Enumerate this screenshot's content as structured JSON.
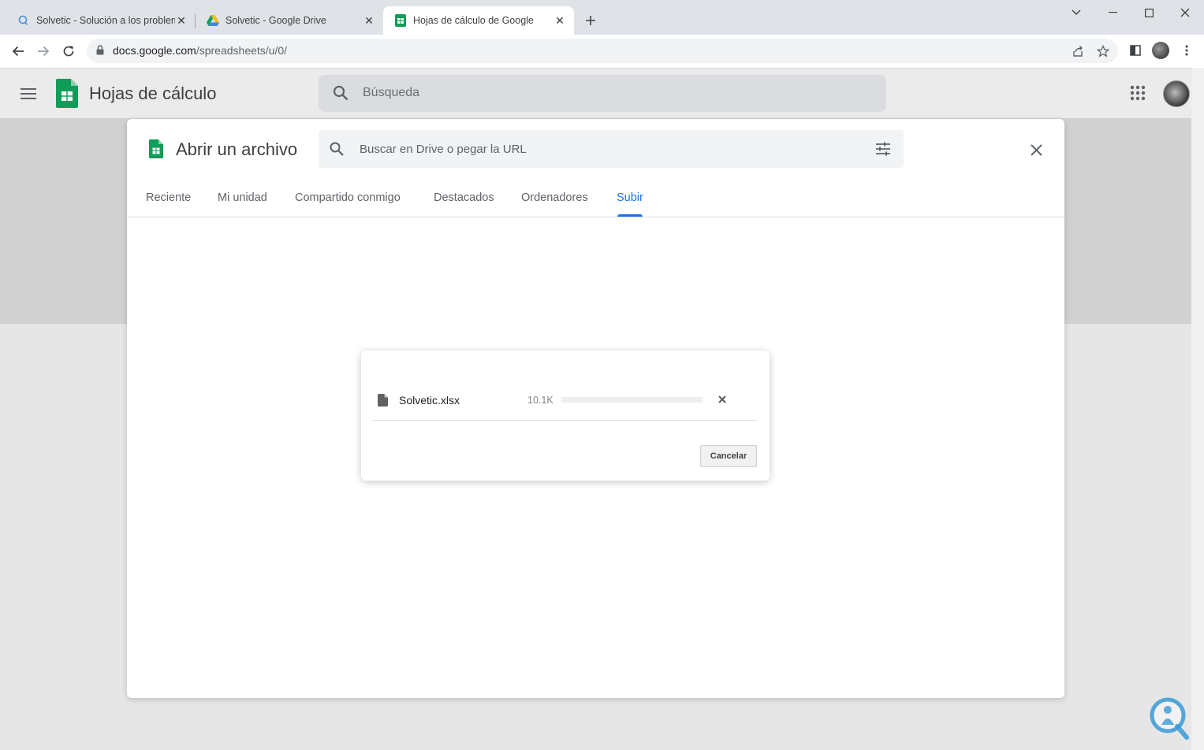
{
  "browser": {
    "tabs": [
      {
        "title": "Solvetic - Solución a los problem",
        "icon": "solvetic-favicon"
      },
      {
        "title": "Solvetic - Google Drive",
        "icon": "drive-favicon"
      },
      {
        "title": "Hojas de cálculo de Google",
        "icon": "sheets-favicon",
        "active": true
      }
    ],
    "url_host": "docs.google.com",
    "url_path": "/spreadsheets/u/0/"
  },
  "app": {
    "title": "Hojas de cálculo",
    "search_placeholder": "Búsqueda"
  },
  "picker": {
    "title": "Abrir un archivo",
    "search_placeholder": "Buscar en Drive o pegar la URL",
    "tabs": [
      "Reciente",
      "Mi unidad",
      "Compartido conmigo",
      "Destacados",
      "Ordenadores",
      "Subir"
    ],
    "active_tab": "Subir"
  },
  "upload": {
    "file_name": "Solvetic.xlsx",
    "file_size": "10.1K",
    "progress_percent": 0,
    "cancel_label": "Cancelar"
  },
  "colors": {
    "accent": "#1a73e8",
    "sheets_green": "#0f9d58"
  }
}
